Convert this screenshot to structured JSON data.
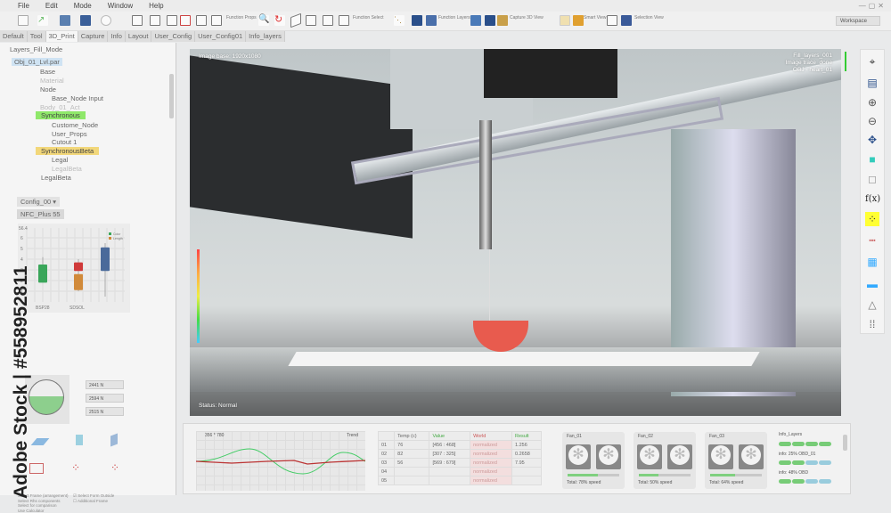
{
  "menu": [
    "File",
    "Edit",
    "Mode",
    "Window",
    "Help"
  ],
  "toolbar": {
    "function_props": "Function Props",
    "function_select": "Function Select",
    "function_layers": "Function Layers",
    "capture_3d": "Capture 3D View",
    "smart_view": "Smart View",
    "selection_view": "Selection View",
    "workspace": "Workspace"
  },
  "tabs": [
    "Default",
    "Tool",
    "3D_Print",
    "Capture",
    "Info",
    "Layout",
    "User_Config",
    "User_Config01",
    "Info_layers"
  ],
  "left": {
    "title": "Layers_Fill_Mode",
    "tree": [
      "Obj_01_Lvl.par",
      "Base",
      "Material",
      "Node",
      "Base_Node Input",
      "Body_01_Act",
      "Synchronous",
      "Custome_Node",
      "User_Props",
      "Cutout 1",
      "SynchronousBeta",
      "Legal",
      "LegalBeta",
      "LegalBeta"
    ],
    "config": "Config_00",
    "nfc": "NFC_Plus 55",
    "spinners": [
      "2441 N",
      "2594 N",
      "2515 N"
    ],
    "checks": [
      "Select Frame (arrangement)",
      "Select Rhs components",
      "Select for comparison",
      "Use Calculator",
      "Select Form Outside",
      "Additional Frame"
    ]
  },
  "chart_data": {
    "type": "box",
    "title": "56.4",
    "categories": [
      "BSP28",
      "SDSOL"
    ],
    "legend": [
      "Color",
      "Length"
    ],
    "yticks": [
      1,
      2,
      3,
      4,
      5,
      6
    ],
    "boxes": [
      {
        "x": "BSP28",
        "low": 1.8,
        "q1": 1.8,
        "q3": 3.5,
        "high": 4.2,
        "color": "#3aa65a"
      },
      {
        "x": "SDSOL",
        "low": 1,
        "q1": 1.1,
        "q3": 2.6,
        "high": 4,
        "color": "#d18a3a"
      },
      {
        "x": "SDSOL",
        "low": 2.8,
        "q1": 2.9,
        "q3": 3.7,
        "high": 4,
        "color": "#d03a3a"
      },
      {
        "x": "SDSOL+",
        "low": 0.5,
        "q1": 2.9,
        "q3": 5.1,
        "high": 5.5,
        "color": "#4a6a9a"
      }
    ]
  },
  "viewport": {
    "image_label": "Image base: 1920x1080",
    "info": [
      "Fill_layers_001",
      "Image trace_done",
      "OBJ - heart_01"
    ],
    "status": "Status: Normal"
  },
  "bottom": {
    "graph_title": "356 * 780",
    "graph_label": "Trend",
    "table": {
      "headers": [
        "Temp (c)",
        "Value",
        "World",
        "Result"
      ],
      "rows": [
        [
          "01",
          "76",
          "[456 : 468]",
          "normalized",
          "1.256"
        ],
        [
          "02",
          "82",
          "[307 : 325]",
          "normalized",
          "0.2658"
        ],
        [
          "03",
          "56",
          "[569 : 679]",
          "normalized",
          "7.95"
        ],
        [
          "04",
          "",
          "",
          "normalized",
          ""
        ],
        [
          "05",
          "",
          "",
          "normalized",
          ""
        ]
      ]
    },
    "fans": [
      {
        "name": "Fan_01",
        "total": "Total: 78% speed",
        "pct": 78
      },
      {
        "name": "Fan_02",
        "total": "Total: 50% speed",
        "pct": 50
      },
      {
        "name": "Fan_03",
        "total": "Total: 64% speed",
        "pct": 64
      }
    ],
    "info_title": "Info_Layers",
    "info_lines": [
      "info: 25% OBD_01",
      "info: 48% OBD"
    ]
  },
  "watermark": "Adobe Stock | #558952811"
}
